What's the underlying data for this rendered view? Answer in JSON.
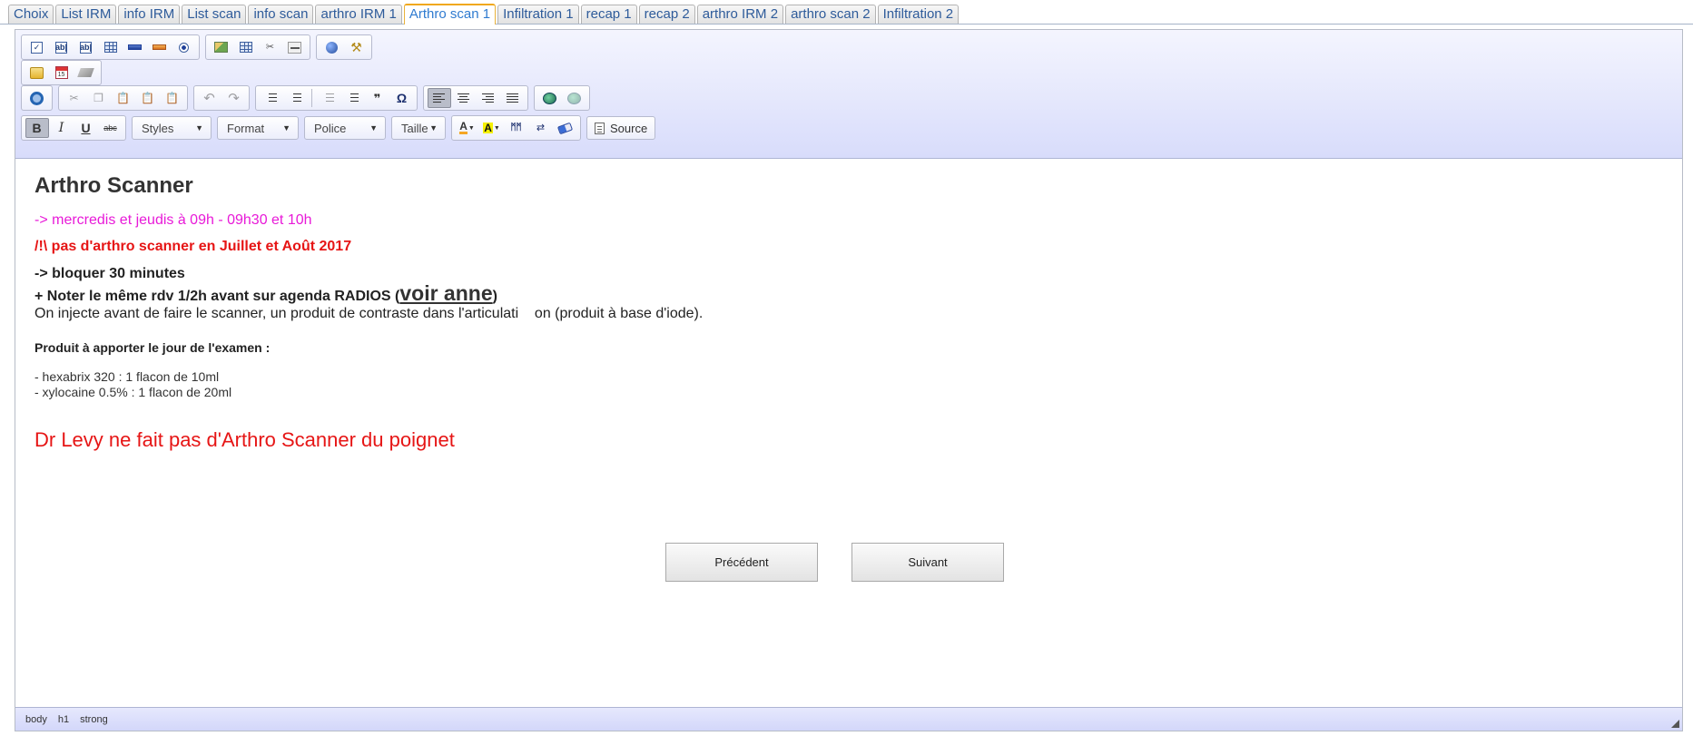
{
  "tabs": [
    {
      "label": "Choix",
      "active": false
    },
    {
      "label": "List IRM",
      "active": false
    },
    {
      "label": "info IRM",
      "active": false
    },
    {
      "label": "List scan",
      "active": false
    },
    {
      "label": "info scan",
      "active": false
    },
    {
      "label": "arthro IRM 1",
      "active": false
    },
    {
      "label": "Arthro scan 1",
      "active": true
    },
    {
      "label": "Infiltration 1",
      "active": false
    },
    {
      "label": "recap 1",
      "active": false
    },
    {
      "label": "recap 2",
      "active": false
    },
    {
      "label": "arthro IRM 2",
      "active": false
    },
    {
      "label": "arthro scan 2",
      "active": false
    },
    {
      "label": "Infiltration 2",
      "active": false
    }
  ],
  "toolbar": {
    "bold": "B",
    "italic": "I",
    "underline": "U",
    "strike": "abc",
    "blockquote": "❞",
    "special_char": "Ω",
    "styles": "Styles",
    "format": "Format",
    "font": "Police",
    "size": "Taille",
    "source": "Source",
    "undo": "↶",
    "redo": "↷",
    "cut": "✂",
    "find": "ᛗᛗ",
    "text_color_label": "A",
    "bg_color_label": "A",
    "text_field": "ab|",
    "textarea": "ab|",
    "cal_day": "15"
  },
  "content": {
    "title": "Arthro Scanner",
    "schedule": "-> mercredis et jeudis à 09h - 09h30 et 10h",
    "warning": "/!\\ pas d'arthro scanner en Juillet et Août 2017",
    "block1": "-> bloquer 30 minutes",
    "block2_prefix": "+ Noter le même rdv 1/2h avant sur agenda RADIOS (",
    "block2_link": "voir anne",
    "block2_suffix": ")",
    "info": "On injecte avant de faire le scanner, un produit de contraste dans l'articulati    on (produit à base d'iode).",
    "products_heading": "Produit à apporter le jour de l'examen :",
    "product1": "- hexabrix 320 : 1 flacon de 10ml",
    "product2": "- xylocaine 0.5% : 1 flacon de 20ml",
    "notice": "Dr Levy ne fait pas d'Arthro Scanner du poignet",
    "prev_button": "Précédent",
    "next_button": "Suivant"
  },
  "statusbar": {
    "path": [
      "body",
      "h1",
      "strong"
    ]
  },
  "colors": {
    "magenta": "#e81ad8",
    "red": "#e61515",
    "tab_active_accent": "#f0a81c",
    "toolbar_gradient_bottom": "#d8dcfb"
  }
}
